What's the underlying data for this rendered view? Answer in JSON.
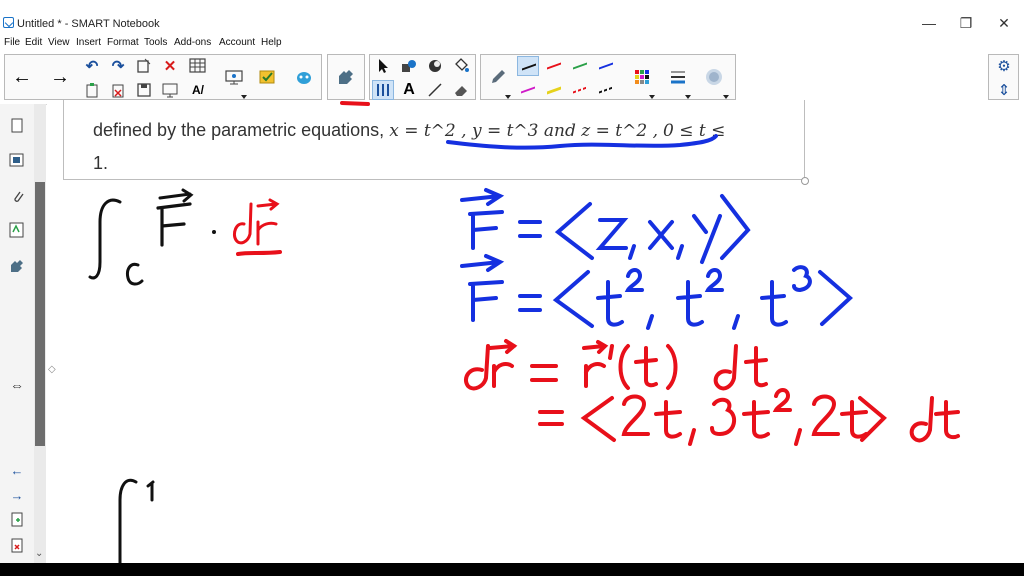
{
  "window": {
    "title": "Untitled * - SMART Notebook",
    "minimize": "—",
    "restore": "❐",
    "close": "✕"
  },
  "menu": [
    "File",
    "Edit",
    "View",
    "Insert",
    "Format",
    "Tools",
    "Add-ons",
    "Account",
    "Help"
  ],
  "toolbar": {
    "back": "←",
    "forward": "→",
    "undo": "↶",
    "redo": "↷",
    "delete": "✕",
    "settings": "⚙",
    "move": "⇕"
  },
  "sidebar": {
    "expand": "⇔",
    "page_prev": "←",
    "page_next": "→",
    "scroll_down": "⌄"
  },
  "problem": {
    "line1_lead": "defined by the parametric equations,",
    "equation": "x = t^2 , y = t^3 and z = t^2 ,",
    "range": "0 ≤ t ≤",
    "line2": "1."
  },
  "ink_notes": {
    "integral": "∫",
    "integral_sub": "c",
    "vector_F": "F",
    "dot": "·",
    "dr": "dr",
    "F_def": "F = ⟨z, x, y⟩",
    "F_param": "F = ⟨t², t², t³⟩",
    "dr_def": "dr = r'(t) dt",
    "dr_param": "= ⟨2t, 3t², 2t⟩ dt",
    "bottom_integral": "∫",
    "bottom_upper": "1"
  },
  "colors": {
    "ink_black": "#111111",
    "ink_blue": "#1530e0",
    "ink_red": "#e8101a",
    "selection": "#cfe3f7"
  }
}
